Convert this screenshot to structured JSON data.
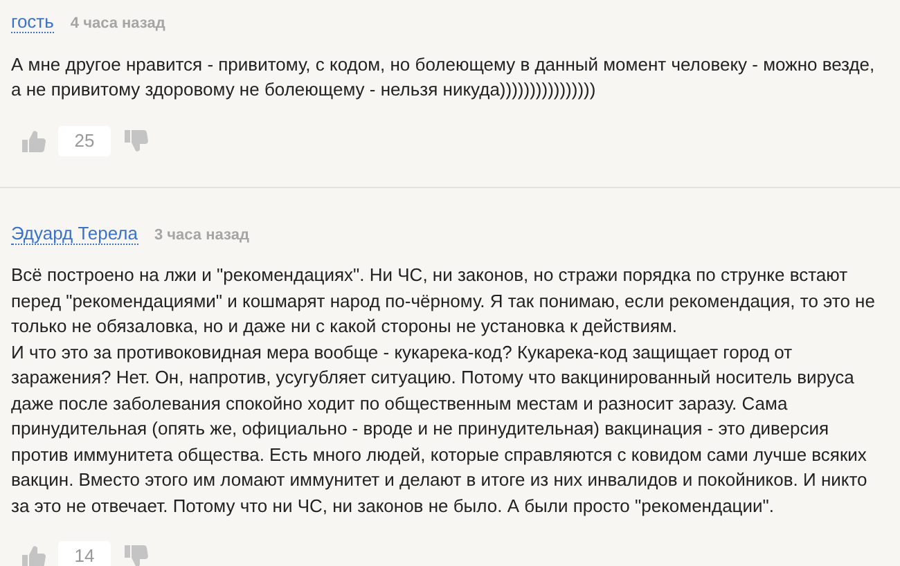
{
  "comments": [
    {
      "author": "гость",
      "time": "4 часа назад",
      "paragraphs": [
        "А мне другое нравится - привитому, с кодом, но болеющему в данный момент человеку - можно везде, а не привитому здоровому не болеющему - нельзя никуда))))))))))))))))"
      ],
      "votes": "25"
    },
    {
      "author": "Эдуард Терела",
      "time": "3 часа назад",
      "paragraphs": [
        "Всё построено на лжи и \"рекомендациях\". Ни ЧС, ни законов, но стражи порядка по струнке встают перед \"рекомендациями\" и кошмарят народ по-чёрному. Я так понимаю, если рекомендация, то это не только не обязаловка, но и даже ни с какой стороны не установка к действиям.",
        "И что это за противоковидная мера вообще - кукарека-код? Кукарека-код защищает город от заражения? Нет. Он, напротив, усугубляет ситуацию. Потому что вакцинированный носитель вируса даже после заболевания спокойно ходит по общественным местам и разносит заразу. Сама принудительная (опять же, официально - вроде и не принудительная) вакцинация - это диверсия против иммунитета общества. Есть много людей, которые справляются с ковидом сами лучше всяких вакцин. Вместо этого им ломают иммунитет и делают в итоге из них инвалидов и покойников. И никто за это не отвечает. Потому что ни ЧС, ни законов не было. А были просто \"рекомендации\"."
      ],
      "votes": "14"
    }
  ]
}
